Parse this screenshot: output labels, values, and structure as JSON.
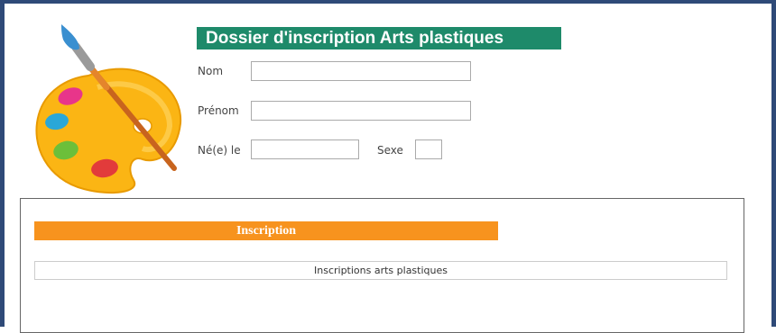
{
  "form": {
    "title": "Dossier d'inscription Arts plastiques",
    "fields": {
      "nom_label": "Nom",
      "prenom_label": "Prénom",
      "ne_le_label": "Né(e) le",
      "sexe_label": "Sexe"
    }
  },
  "section": {
    "header": "Inscription",
    "row_label": "Inscriptions arts plastiques"
  },
  "colors": {
    "frame": "#2f4a78",
    "title_bg": "#1e8a6a",
    "section_band": "#f7931e"
  },
  "icons": {
    "palette": "paint-palette-with-brush-icon"
  }
}
